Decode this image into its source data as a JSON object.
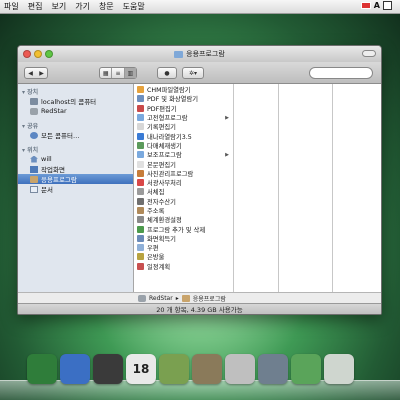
{
  "menubar": {
    "items": [
      "파일",
      "편집",
      "보기",
      "가기",
      "창문",
      "도움말"
    ],
    "right_label": "A"
  },
  "window": {
    "title": "응용프로그람",
    "search_placeholder": ""
  },
  "sidebar": {
    "sections": [
      {
        "header": "장치",
        "items": [
          "localhost의 콤퓨터",
          "RedStar"
        ]
      },
      {
        "header": "공유",
        "items": [
          "모든 콤퓨터…"
        ]
      },
      {
        "header": "위치",
        "items": [
          "will",
          "작업화면",
          "응용프로그람",
          "문서"
        ]
      }
    ],
    "selected": "응용프로그람"
  },
  "column1": {
    "items": [
      {
        "label": "CHM파일열람기",
        "color": "#e6a23c",
        "arrow": false
      },
      {
        "label": "PDF 및 화상열람기",
        "color": "#6c8fbf",
        "arrow": false
      },
      {
        "label": "PDF편집기",
        "color": "#c94a4a",
        "arrow": false
      },
      {
        "label": "고전형프로그람",
        "color": "#7aa9de",
        "arrow": true
      },
      {
        "label": "기록편집기",
        "color": "#d7d7d7",
        "arrow": false
      },
      {
        "label": "내나라열람기3.5",
        "color": "#3a7bd5",
        "arrow": false
      },
      {
        "label": "다매체재생기",
        "color": "#5b9a5b",
        "arrow": false
      },
      {
        "label": "보조프로그람",
        "color": "#7aa9de",
        "arrow": true
      },
      {
        "label": "본문편집기",
        "color": "#e0e0e0",
        "arrow": false
      },
      {
        "label": "사진관리프로그람",
        "color": "#c77d3a",
        "arrow": false
      },
      {
        "label": "서광사무처리",
        "color": "#d94848",
        "arrow": false
      },
      {
        "label": "서체집",
        "color": "#9b9b9b",
        "arrow": false
      },
      {
        "label": "전자수산기",
        "color": "#6f6f6f",
        "arrow": false
      },
      {
        "label": "주소록",
        "color": "#b08a5a",
        "arrow": false
      },
      {
        "label": "체계환경설정",
        "color": "#8a8a8a",
        "arrow": false
      },
      {
        "label": "프로그람 추가 및 삭제",
        "color": "#4c9a4c",
        "arrow": false
      },
      {
        "label": "화면획득기",
        "color": "#6a8ab8",
        "arrow": false
      },
      {
        "label": "우편",
        "color": "#8fb0d8",
        "arrow": false
      },
      {
        "label": "은방울",
        "color": "#b8a340",
        "arrow": false
      },
      {
        "label": "일정계획",
        "color": "#c85050",
        "arrow": false
      }
    ]
  },
  "pathbar": {
    "segments": [
      "RedStar",
      "응용프로그람"
    ]
  },
  "status": {
    "text": "20 개 항목, 4.39 GB 사용가능"
  },
  "dock": {
    "items": [
      {
        "name": "finder-icon",
        "color": "#2f7d3a"
      },
      {
        "name": "browser-icon",
        "color": "#3b6fc4"
      },
      {
        "name": "media-icon",
        "color": "#3a3a3a"
      },
      {
        "name": "calendar-icon",
        "color": "#e9e9e9",
        "text": "18"
      },
      {
        "name": "address-book-icon",
        "color": "#7aa050"
      },
      {
        "name": "photo-icon",
        "color": "#8a7a5a"
      },
      {
        "name": "calculator-icon",
        "color": "#bfbfbf"
      },
      {
        "name": "settings-icon",
        "color": "#6f7f8f"
      },
      {
        "name": "download-icon",
        "color": "#5aa45a"
      },
      {
        "name": "trash-icon",
        "color": "#cfd6cf"
      }
    ]
  }
}
